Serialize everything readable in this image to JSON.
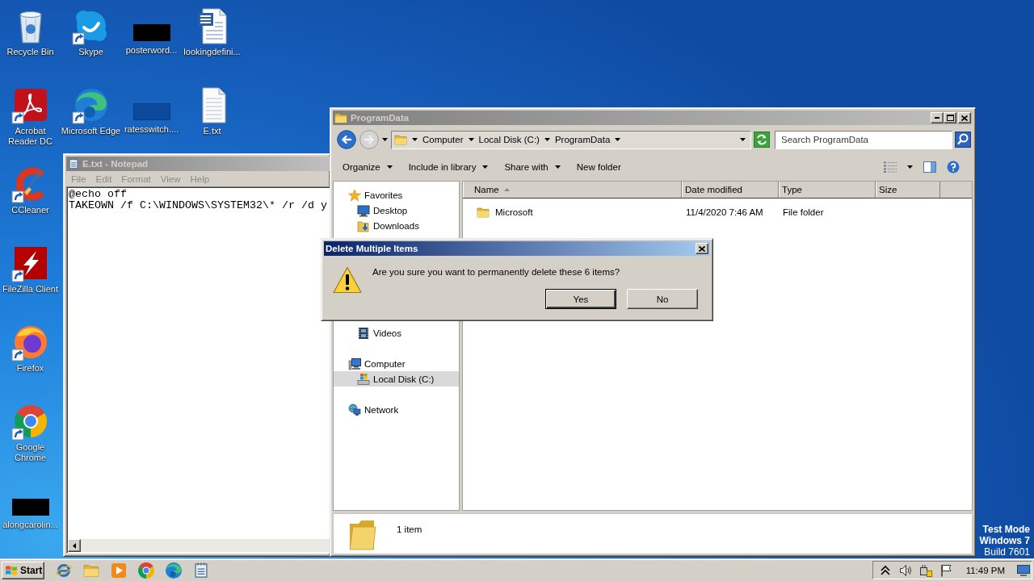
{
  "desktop": {
    "icon_columns": [
      [
        {
          "label": "Recycle Bin",
          "kind": "recycle-bin",
          "shortcut": false
        },
        {
          "label": "Acrobat Reader DC",
          "kind": "acrobat",
          "shortcut": true
        },
        {
          "label": "CCleaner",
          "kind": "ccleaner",
          "shortcut": true
        },
        {
          "label": "FileZilla Client",
          "kind": "filezilla",
          "shortcut": true
        },
        {
          "label": "Firefox",
          "kind": "firefox",
          "shortcut": true
        },
        {
          "label": "Google Chrome",
          "kind": "chrome",
          "shortcut": true
        },
        {
          "label": "alongcarolin...",
          "kind": "blackout",
          "shortcut": false
        }
      ],
      [
        {
          "label": "Skype",
          "kind": "skype",
          "shortcut": true
        },
        {
          "label": "Microsoft Edge",
          "kind": "edge",
          "shortcut": true
        }
      ],
      [
        {
          "label": "posterword...",
          "kind": "blackout",
          "shortcut": false
        },
        {
          "label": "ratesswitch....",
          "kind": "dark-thumbnail",
          "shortcut": false
        }
      ],
      [
        {
          "label": "lookingdefini...",
          "kind": "word-document",
          "shortcut": false
        },
        {
          "label": "E.txt",
          "kind": "text-file",
          "shortcut": false
        }
      ]
    ],
    "notice": [
      {
        "text": "Test Mode",
        "bold": true
      },
      {
        "text": "Windows 7",
        "bold": true
      },
      {
        "text": "Build 7601",
        "bold": false
      }
    ]
  },
  "notepad": {
    "title": "E.txt - Notepad",
    "active": false,
    "menu": [
      "File",
      "Edit",
      "Format",
      "View",
      "Help"
    ],
    "lines": [
      "@echo off",
      "TAKEOWN /f C:\\WINDOWS\\SYSTEM32\\* /r /d y"
    ]
  },
  "explorer": {
    "title": "ProgramData",
    "active": false,
    "nav": [
      {
        "kind": "back",
        "disabled": false
      },
      {
        "kind": "forward",
        "disabled": true
      }
    ],
    "breadcrumb": [
      "Computer",
      "Local Disk (C:)",
      "ProgramData"
    ],
    "search": {
      "placeholder": "Search ProgramData"
    },
    "toolbar": [
      {
        "label": "Organize",
        "dropdown": true
      },
      {
        "label": "Include in library",
        "dropdown": true
      },
      {
        "label": "Share with",
        "dropdown": true
      },
      {
        "label": "New folder",
        "dropdown": false
      }
    ],
    "sidebar": [
      {
        "label": "Favorites",
        "kind": "star",
        "selected": false,
        "children": [
          {
            "label": "Desktop",
            "kind": "desktop",
            "selected": false
          },
          {
            "label": "Downloads",
            "kind": "downloads",
            "selected": false
          }
        ]
      },
      {
        "children": [
          {
            "label": "Videos",
            "kind": "videos",
            "selected": false
          }
        ]
      },
      {
        "label": "Computer",
        "kind": "computer",
        "selected": false,
        "children": [
          {
            "label": "Local Disk (C:)",
            "kind": "drive",
            "selected": true
          }
        ]
      },
      {
        "label": "Network",
        "kind": "network",
        "selected": false
      }
    ],
    "columns": [
      {
        "label": "Name",
        "sorted": true
      },
      {
        "label": "Date modified",
        "sorted": false
      },
      {
        "label": "Type",
        "sorted": false
      },
      {
        "label": "Size",
        "sorted": false
      }
    ],
    "rows": [
      {
        "name": "Microsoft",
        "date_modified": "11/4/2020 7:46 AM",
        "type": "File folder",
        "selected": false
      }
    ],
    "status": "1 item"
  },
  "dialog": {
    "title": "Delete Multiple Items",
    "active": true,
    "message": "Are you sure you want to permanently delete these 6 items?",
    "buttons": [
      {
        "label": "Yes",
        "default": true
      },
      {
        "label": "No",
        "default": false
      }
    ]
  },
  "taskbar": {
    "start": "Start",
    "apps": [
      {
        "kind": "internet-explorer"
      },
      {
        "kind": "folder"
      },
      {
        "kind": "media-player"
      },
      {
        "kind": "chrome"
      },
      {
        "kind": "edge"
      },
      {
        "kind": "notepad"
      }
    ],
    "tray": [
      {
        "kind": "chevron"
      },
      {
        "kind": "speaker"
      },
      {
        "kind": "power"
      },
      {
        "kind": "flag"
      }
    ],
    "clock": "11:49 PM"
  }
}
